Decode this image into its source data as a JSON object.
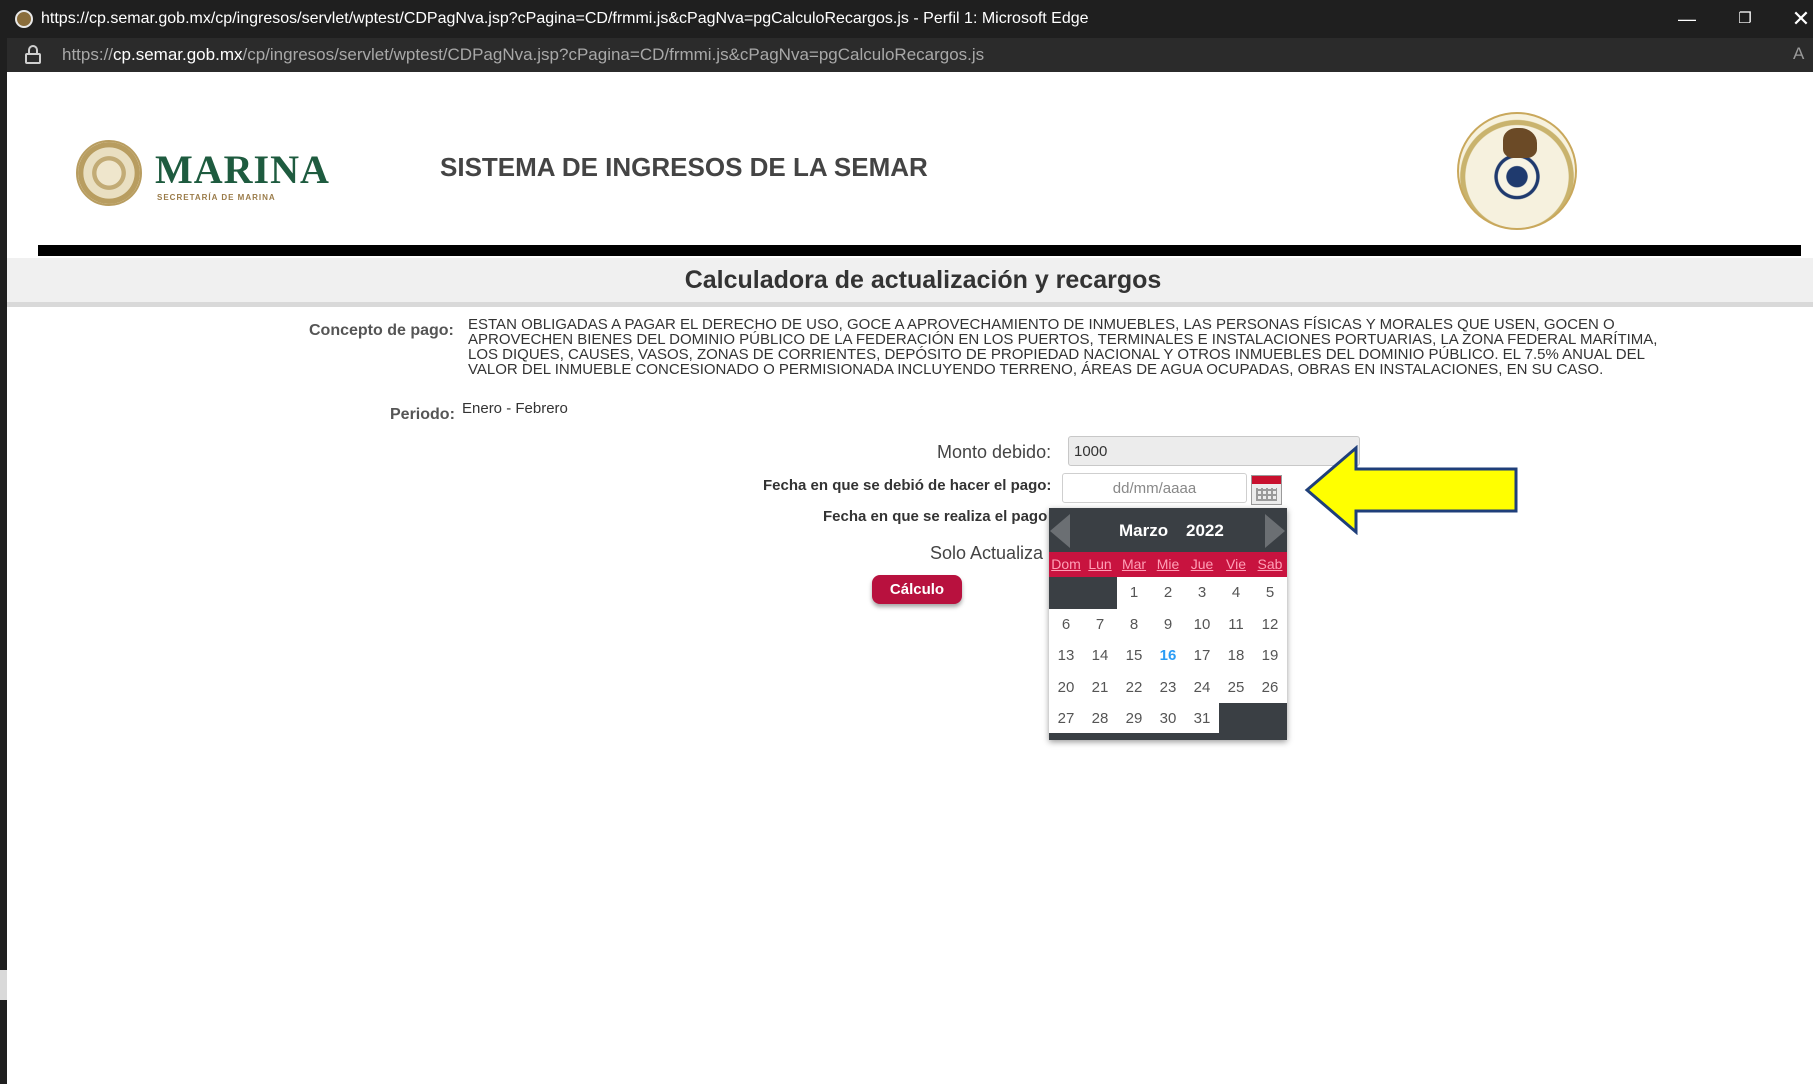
{
  "browser": {
    "window_title": "https://cp.semar.gob.mx/cp/ingresos/servlet/wptest/CDPagNva.jsp?cPagina=CD/frmmi.js&cPagNva=pgCalculoRecargos.js - Perfil 1: Microsoft Edge",
    "url_prefix": "https://",
    "url_host": "cp.semar.gob.mx",
    "url_path": "/cp/ingresos/servlet/wptest/CDPagNva.jsp?cPagina=CD/frmmi.js&cPagNva=pgCalculoRecargos.js",
    "min_glyph": "—",
    "restore_glyph": "❐",
    "close_glyph": "✕",
    "read_aloud_glyph": "A"
  },
  "header": {
    "logo_text": "MARINA",
    "logo_subtext": "SECRETARÍA DE MARINA",
    "system_title": "SISTEMA DE INGRESOS DE LA SEMAR"
  },
  "calculator": {
    "title": "Calculadora de actualización y recargos",
    "concept_label": "Concepto de pago:",
    "concept_text": "ESTAN OBLIGADAS A PAGAR EL DERECHO DE USO, GOCE A APROVECHAMIENTO DE INMUEBLES, LAS PERSONAS FÍSICAS Y MORALES QUE USEN, GOCEN O APROVECHEN BIENES DEL DOMINIO PÚBLICO DE LA FEDERACIÓN EN LOS PUERTOS, TERMINALES E INSTALACIONES PORTUARIAS, LA ZONA FEDERAL MARÍTIMA, LOS DIQUES, CAUSES, VASOS, ZONAS DE CORRIENTES, DEPÓSITO DE PROPIEDAD NACIONAL Y OTROS INMUEBLES DEL DOMINIO PÚBLICO. EL 7.5% ANUAL DEL VALOR DEL INMUEBLE CONCESIONADO O PERMISIONADA INCLUYENDO TERRENO, ÁREAS DE AGUA OCUPADAS, OBRAS EN INSTALACIONES, EN SU CASO.",
    "period_label": "Periodo:",
    "period_value": "Enero - Febrero",
    "monto_label": "Monto debido:",
    "monto_value": "1000",
    "fecha_debio_label": "Fecha en que se debió de hacer el pago:",
    "fecha_debio_placeholder": "dd/mm/aaaa",
    "fecha_realiza_label": "Fecha en que se realiza el pago",
    "solo_label": "Solo Actualiza",
    "calc_button": "Cálculo"
  },
  "datepicker": {
    "month": "Marzo",
    "year": "2022",
    "weekdays": [
      "Dom",
      "Lun",
      "Mar",
      "Mie",
      "Jue",
      "Vie",
      "Sab"
    ],
    "today": "16",
    "cells": [
      "",
      "",
      "1",
      "2",
      "3",
      "4",
      "5",
      "6",
      "7",
      "8",
      "9",
      "10",
      "11",
      "12",
      "13",
      "14",
      "15",
      "16",
      "17",
      "18",
      "19",
      "20",
      "21",
      "22",
      "23",
      "24",
      "25",
      "26",
      "27",
      "28",
      "29",
      "30",
      "31",
      "",
      ""
    ]
  },
  "colors": {
    "arrow_fill": "#ffff00",
    "arrow_stroke": "#1f3f7a",
    "accent_red": "#c8133f",
    "button_red": "#b8113e",
    "today_blue": "#2a9cf5"
  },
  "icons": {
    "calendar": "calendar-icon",
    "lock": "lock-icon",
    "arrow": "pointer-arrow-icon"
  }
}
